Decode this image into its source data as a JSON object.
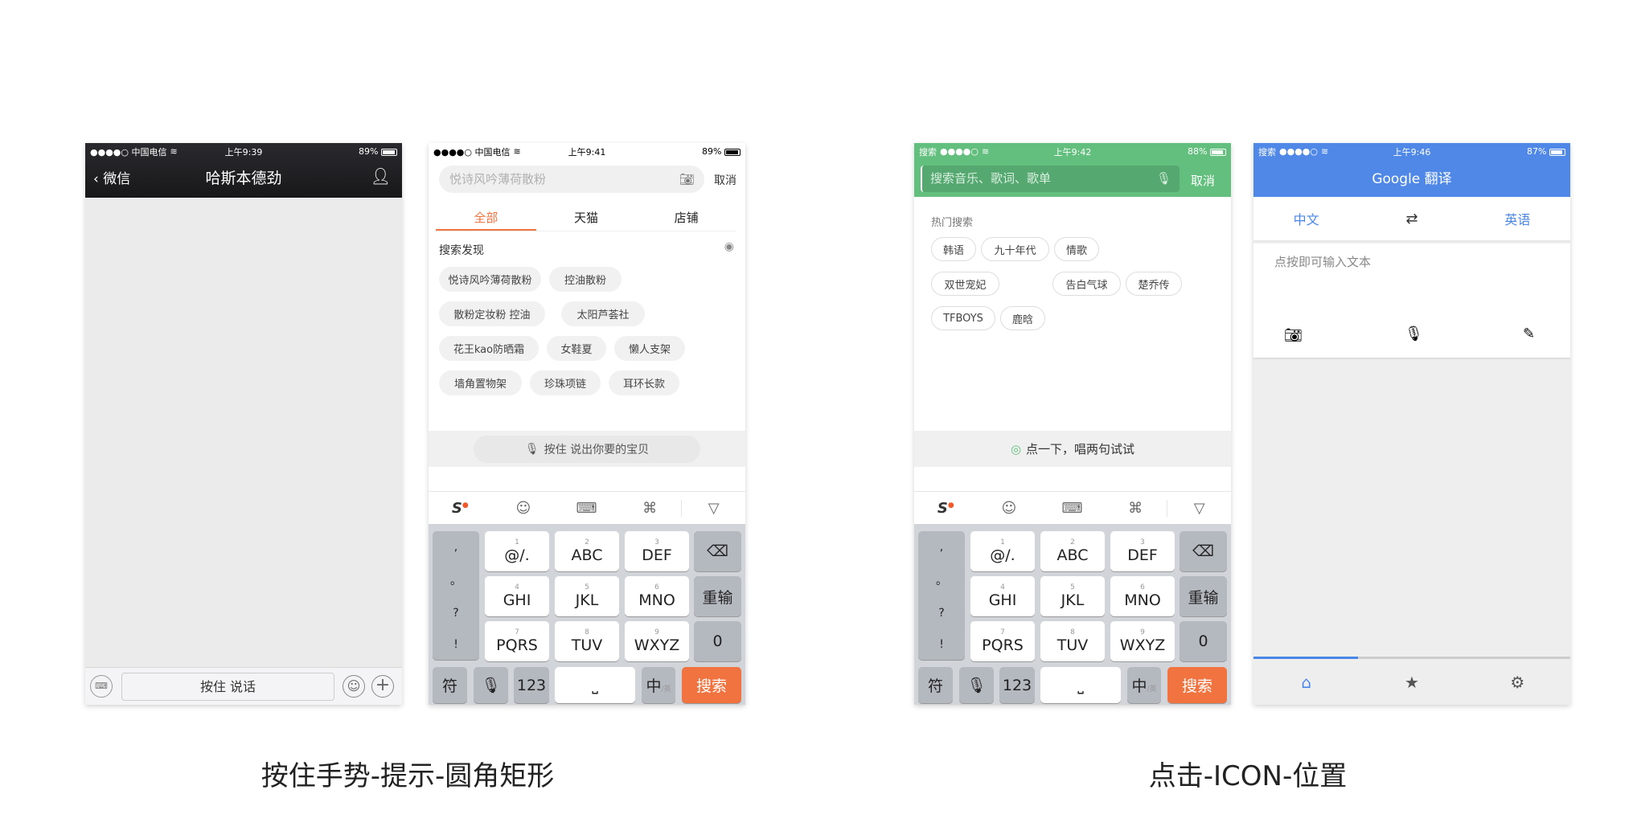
{
  "captions": {
    "left": "按住手势-提示-圆角矩形",
    "right": "点击-ICON-位置"
  },
  "colors": {
    "wechat_nav": "#1e1e21",
    "taobao_orange": "#f07340",
    "music_green": "#62bf7e",
    "google_blue": "#5088e8"
  },
  "wechat": {
    "status": {
      "carrier": "●●●●○ 中国电信",
      "time": "上午9:39",
      "battery": "89%"
    },
    "back": "微信",
    "title": "哈斯本德劲",
    "hold_to_talk": "按住 说话"
  },
  "taobao": {
    "status": {
      "carrier": "●●●●○ 中国电信",
      "time": "上午9:41",
      "battery": "89%"
    },
    "search_placeholder": "悦诗风吟薄荷散粉",
    "cancel": "取消",
    "tabs": [
      {
        "label": "全部",
        "active": true
      },
      {
        "label": "天猫"
      },
      {
        "label": "店铺"
      }
    ],
    "discover_title": "搜索发现",
    "chips": [
      "悦诗风吟薄荷散粉",
      "控油散粉",
      "散粉定妆粉 控油",
      "太阳芦荟社",
      "花王kao防晒霜",
      "女鞋夏",
      "懒人支架",
      "墙角置物架",
      "珍珠项链",
      "耳环长款"
    ],
    "voice_hint": "按住  说出你要的宝贝"
  },
  "music": {
    "status": {
      "back": "搜索",
      "carrier": "●●●●○",
      "time": "上午9:42",
      "battery": "88%"
    },
    "search_placeholder": "搜索音乐、歌词、歌单",
    "cancel": "取消",
    "hot_title": "热门搜索",
    "chips": [
      "韩语",
      "九十年代",
      "情歌",
      "双世宠妃",
      "告白气球",
      "楚乔传",
      "TFBOYS",
      "鹿晗"
    ],
    "voice_hint": "点一下，唱两句试试"
  },
  "keyboard": {
    "left_col": [
      ",",
      "。",
      "?",
      "!"
    ],
    "keys": [
      {
        "num": "1",
        "label": "@/."
      },
      {
        "num": "2",
        "label": "ABC"
      },
      {
        "num": "3",
        "label": "DEF"
      },
      {
        "num": "4",
        "label": "GHI"
      },
      {
        "num": "5",
        "label": "JKL"
      },
      {
        "num": "6",
        "label": "MNO"
      },
      {
        "num": "7",
        "label": "PQRS"
      },
      {
        "num": "8",
        "label": "TUV"
      },
      {
        "num": "9",
        "label": "WXYZ"
      }
    ],
    "retype": "重输",
    "zero": "0",
    "symbol": "符",
    "num123": "123",
    "lang": "中",
    "lang_sub": "/英",
    "search": "搜索",
    "space": "⎵"
  },
  "google": {
    "status": {
      "back": "搜索",
      "carrier": "●●●●○",
      "time": "上午9:46",
      "battery": "87%"
    },
    "title": "Google 翻译",
    "source_lang": "中文",
    "target_lang": "英语",
    "input_placeholder": "点按即可输入文本",
    "progress": 0.33
  }
}
